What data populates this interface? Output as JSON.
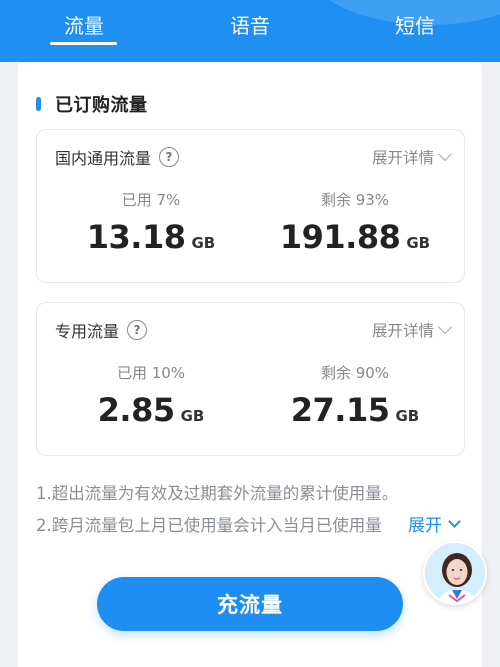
{
  "tabs": [
    {
      "label": "流量",
      "active": true
    },
    {
      "label": "语音",
      "active": false
    },
    {
      "label": "短信",
      "active": false
    }
  ],
  "section_title": "已订购流量",
  "plans": [
    {
      "name": "国内通用流量",
      "expand_label": "展开详情",
      "used_label": "已用 7%",
      "used_value": "13.18",
      "remaining_label": "剩余 93%",
      "remaining_value": "191.88",
      "unit": "GB"
    },
    {
      "name": "专用流量",
      "expand_label": "展开详情",
      "used_label": "已用 10%",
      "used_value": "2.85",
      "remaining_label": "剩余 90%",
      "remaining_value": "27.15",
      "unit": "GB"
    }
  ],
  "notes": [
    "1.超出流量为有效及过期套外流量的累计使用量。",
    "2.跨月流量包上月已使用量会计入当月已使用量"
  ],
  "notes_expand_label": "展开",
  "recharge_label": "充流量",
  "help_icon_glyph": "?",
  "colors": {
    "brand_blue": "#1f8ff0",
    "text_primary": "#222222",
    "text_secondary": "#888888",
    "background": "#eef0f4"
  }
}
